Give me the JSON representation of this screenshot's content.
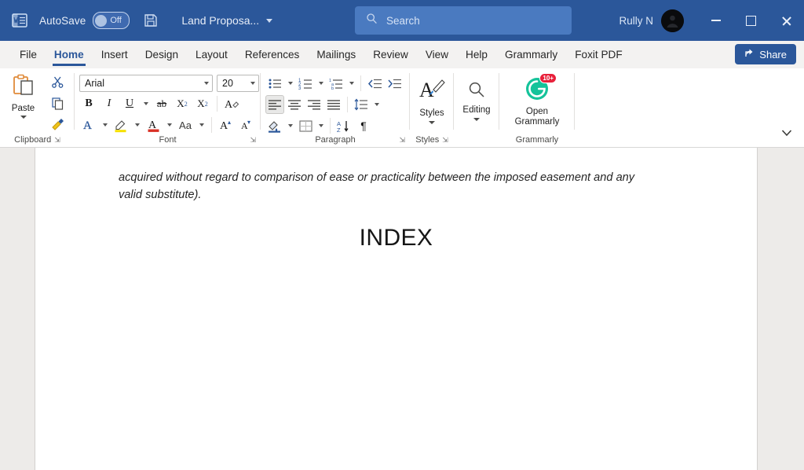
{
  "titlebar": {
    "app_icon": "word-logo-icon",
    "autosave_label": "AutoSave",
    "autosave_state": "Off",
    "save_icon": "save-icon",
    "document_name": "Land Proposa...",
    "search_placeholder": "Search",
    "search_value": "",
    "search_icon": "search-icon",
    "user_name": "Rully N",
    "avatar_initials": "",
    "minimize_label": "Minimize",
    "maximize_label": "Maximize",
    "close_label": "Close",
    "accent_color": "#2b579a",
    "search_bg": "#4a7ac0"
  },
  "tabs": [
    {
      "label": "File",
      "active": false
    },
    {
      "label": "Home",
      "active": true
    },
    {
      "label": "Insert",
      "active": false
    },
    {
      "label": "Design",
      "active": false
    },
    {
      "label": "Layout",
      "active": false
    },
    {
      "label": "References",
      "active": false
    },
    {
      "label": "Mailings",
      "active": false
    },
    {
      "label": "Review",
      "active": false
    },
    {
      "label": "View",
      "active": false
    },
    {
      "label": "Help",
      "active": false
    },
    {
      "label": "Grammarly",
      "active": false
    },
    {
      "label": "Foxit PDF",
      "active": false
    }
  ],
  "share": {
    "label": "Share",
    "icon": "share-icon"
  },
  "ribbon": {
    "clipboard": {
      "group_label": "Clipboard",
      "paste_label": "Paste",
      "paste_icon": "clipboard-paste-icon",
      "cut_icon": "scissors-icon",
      "copy_icon": "copy-icon",
      "format_painter_icon": "format-painter-icon",
      "dialog_launcher_icon": "dialog-launcher-icon"
    },
    "font": {
      "group_label": "Font",
      "font_name": "Arial",
      "font_size": "20",
      "bold_label": "B",
      "italic_label": "I",
      "underline_label": "U",
      "strikethrough_label": "ab",
      "subscript_label": "X",
      "superscript_label": "X",
      "clear_formatting_icon": "clear-formatting-icon",
      "text_effects_icon": "text-effects-icon",
      "highlight_icon": "text-highlight-icon",
      "font_color_icon": "font-color-icon",
      "change_case_label": "Aa",
      "grow_font_label": "A",
      "shrink_font_label": "A",
      "dialog_launcher_icon": "dialog-launcher-icon"
    },
    "paragraph": {
      "group_label": "Paragraph",
      "bullets_icon": "bullet-list-icon",
      "numbering_icon": "numbered-list-icon",
      "multilevel_icon": "multilevel-list-icon",
      "decrease_indent_icon": "decrease-indent-icon",
      "increase_indent_icon": "increase-indent-icon",
      "align_left_icon": "align-left-icon",
      "align_center_icon": "align-center-icon",
      "align_right_icon": "align-right-icon",
      "justify_icon": "justify-icon",
      "line_spacing_icon": "line-spacing-icon",
      "shading_icon": "shading-icon",
      "borders_icon": "borders-icon",
      "sort_icon": "sort-icon",
      "show_marks_label": "¶",
      "dialog_launcher_icon": "dialog-launcher-icon",
      "active_alignment": "align-left-icon"
    },
    "styles": {
      "group_label": "Styles",
      "button_label": "Styles",
      "icon": "styles-icon",
      "dialog_launcher_icon": "dialog-launcher-icon"
    },
    "editing": {
      "group_label": "",
      "button_label": "Editing",
      "icon": "search-icon"
    },
    "grammarly": {
      "group_label": "Grammarly",
      "button_label_line1": "Open",
      "button_label_line2": "Grammarly",
      "icon": "grammarly-logo-icon",
      "badge": "10+",
      "badge_color": "#e8203a",
      "brand_color": "#15c39a"
    },
    "collapse_icon": "chevron-down-icon"
  },
  "document": {
    "paragraph": "acquired without regard to comparison of ease or practicality between the imposed easement and any valid substitute).",
    "heading": "INDEX",
    "page_bg": "#ffffff",
    "canvas_bg": "#edebe9"
  }
}
